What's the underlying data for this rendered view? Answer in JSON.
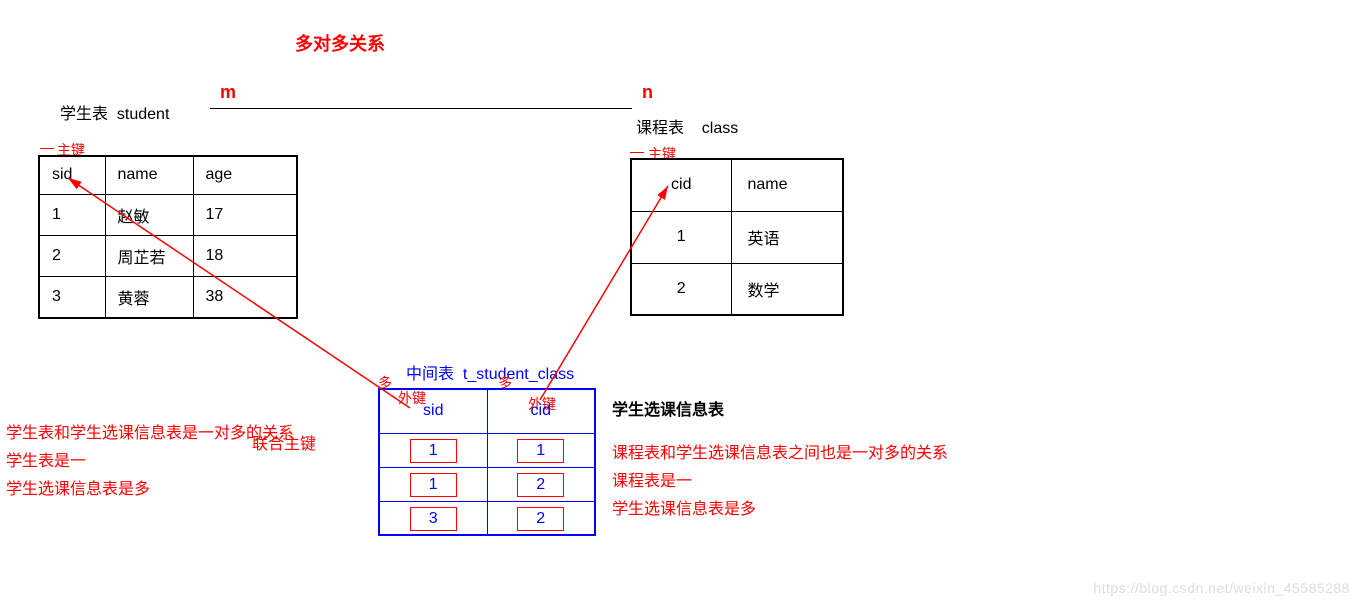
{
  "title": "多对多关系",
  "rel": {
    "m": "m",
    "n": "n"
  },
  "student": {
    "label_cn": "学生表",
    "label_en": "student",
    "pk_label": "主键",
    "headers": {
      "sid": "sid",
      "name": "name",
      "age": "age"
    },
    "rows": [
      {
        "sid": "1",
        "name": "赵敏",
        "age": "17"
      },
      {
        "sid": "2",
        "name": "周芷若",
        "age": "18"
      },
      {
        "sid": "3",
        "name": "黄蓉",
        "age": "38"
      }
    ]
  },
  "class": {
    "label_cn": "课程表",
    "label_en": "class",
    "pk_label": "主键",
    "headers": {
      "cid": "cid",
      "name": "name"
    },
    "rows": [
      {
        "cid": "1",
        "name": "英语"
      },
      {
        "cid": "2",
        "name": "数学"
      }
    ]
  },
  "mid": {
    "label_cn": "中间表",
    "label_en": "t_student_class",
    "right_label": "学生选课信息表",
    "multi": "多",
    "fk": "外键",
    "joint_pk": "联合主键",
    "headers": {
      "sid": "sid",
      "cid": "cid"
    },
    "rows": [
      {
        "sid": "1",
        "cid": "1"
      },
      {
        "sid": "1",
        "cid": "2"
      },
      {
        "sid": "3",
        "cid": "2"
      }
    ]
  },
  "left_notes": {
    "l1": "学生表和学生选课信息表是一对多的关系",
    "l2": "学生表是一",
    "l3": "学生选课信息表是多"
  },
  "right_notes": {
    "l1": "课程表和学生选课信息表之间也是一对多的关系",
    "l2": "课程表是一",
    "l3": "学生选课信息表是多"
  },
  "watermark": "https://blog.csdn.net/weixin_45585288"
}
